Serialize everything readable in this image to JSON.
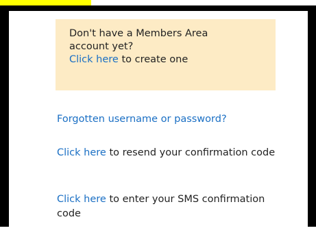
{
  "info_box": {
    "text_line1": "Don't have a Members Area",
    "text_line2": "account yet?",
    "link": "Click here",
    "link_suffix": " to create one"
  },
  "forgotten": {
    "link": "Forgotten username or password?"
  },
  "resend": {
    "link": "Click here",
    "suffix": " to resend your confirmation code"
  },
  "sms": {
    "link": "Click here",
    "suffix": " to enter your SMS confirmation code"
  },
  "colors": {
    "link": "#1a6fc4",
    "info_bg": "#fdebc5",
    "frame": "#000000",
    "highlight": "#ffff00"
  }
}
